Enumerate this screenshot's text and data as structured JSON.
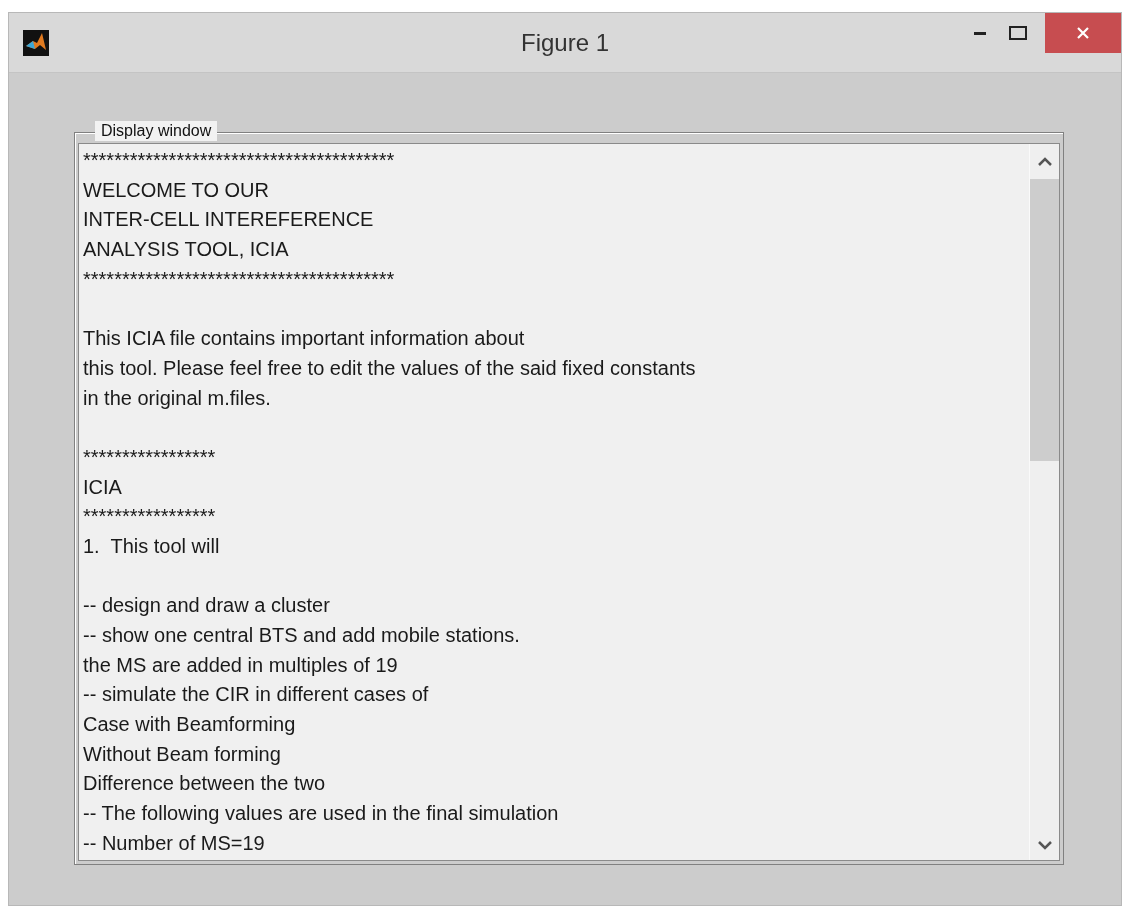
{
  "window": {
    "title": "Figure 1"
  },
  "panel": {
    "title": "Display window"
  },
  "lines": [
    {
      "kind": "text",
      "text": "****************************************"
    },
    {
      "kind": "text",
      "text": "WELCOME TO OUR"
    },
    {
      "kind": "text",
      "text": "INTER-CELL INTEREFERENCE"
    },
    {
      "kind": "text",
      "text": "ANALYSIS TOOL, ICIA"
    },
    {
      "kind": "text",
      "text": "****************************************"
    },
    {
      "kind": "blank"
    },
    {
      "kind": "text",
      "text": "This ICIA file contains important information about"
    },
    {
      "kind": "text",
      "text": "this tool. Please feel free to edit the values of the said fixed constants"
    },
    {
      "kind": "text",
      "text": "in the original m.files."
    },
    {
      "kind": "blank"
    },
    {
      "kind": "text",
      "text": "*****************"
    },
    {
      "kind": "text",
      "text": "ICIA"
    },
    {
      "kind": "text",
      "text": "*****************"
    },
    {
      "kind": "text",
      "text": "1.  This tool will"
    },
    {
      "kind": "blank"
    },
    {
      "kind": "text",
      "text": "-- design and draw a cluster"
    },
    {
      "kind": "text",
      "text": "-- show one central BTS and add mobile stations."
    },
    {
      "kind": "text",
      "text": "the MS are added in multiples of 19"
    },
    {
      "kind": "text",
      "text": "-- simulate the CIR in different cases of"
    },
    {
      "kind": "text",
      "text": "Case with Beamforming"
    },
    {
      "kind": "text",
      "text": "Without Beam forming"
    },
    {
      "kind": "text",
      "text": "Difference between the two"
    },
    {
      "kind": "text",
      "text": "-- The following values are used in the final simulation"
    },
    {
      "kind": "text",
      "text": "-- Number of MS=19"
    }
  ]
}
